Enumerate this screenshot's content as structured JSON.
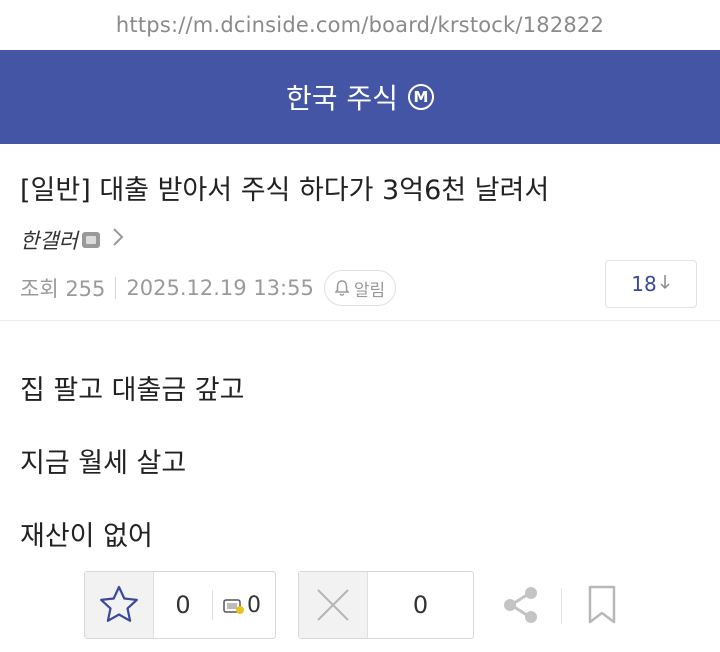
{
  "browser": {
    "url": "https://m.dcinside.com/board/krstock/182822"
  },
  "header": {
    "gallery_name": "한국 주식",
    "badge": "M"
  },
  "post": {
    "title": "[일반] 대출 받아서 주식 하다가 3억6천 날려서",
    "author": "한갤러",
    "views": "조회 255",
    "date": "2025.12.19 13:55",
    "alarm_label": "알림",
    "comment_count": "18",
    "body": [
      "집 팔고 대출금 갚고",
      "지금 월세 살고",
      "재산이 없어"
    ]
  },
  "reactions": {
    "upvotes": "0",
    "fixed_upvotes": "0",
    "downvotes": "0"
  },
  "icons": [
    "star-icon",
    "x-icon",
    "share-icon",
    "bookmark-icon",
    "bell-icon",
    "gallery-member-icon",
    "chevron-right-icon",
    "arrow-down-icon"
  ],
  "colors": {
    "header_bg": "#4555a6",
    "count_text": "#3a4a9a"
  }
}
